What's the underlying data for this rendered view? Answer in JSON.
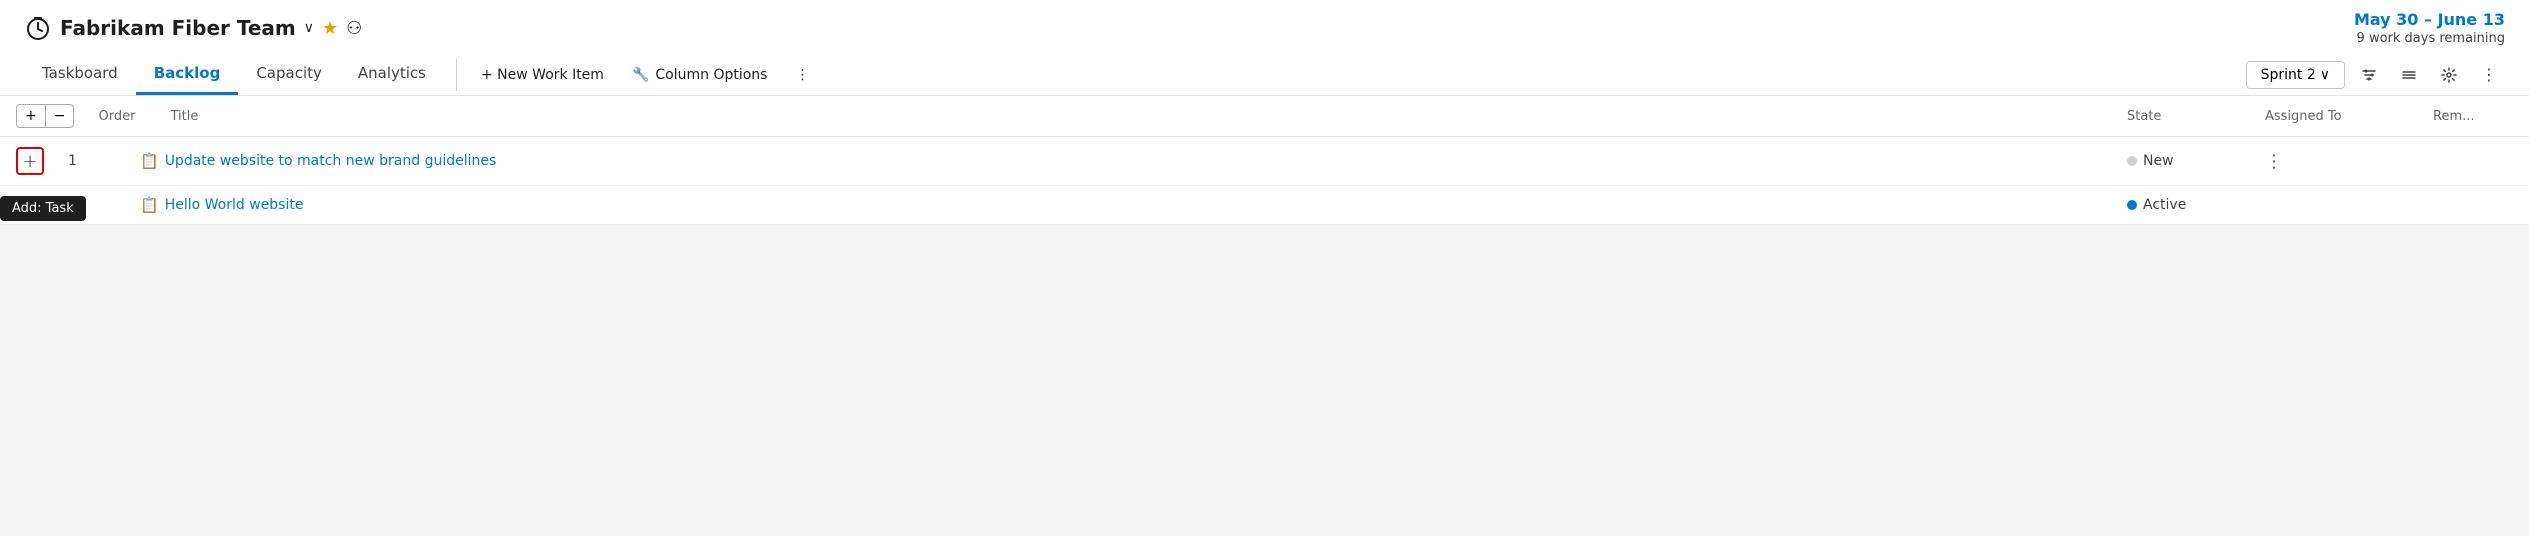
{
  "header": {
    "team_name": "Fabrikam Fiber Team",
    "chevron": "∨",
    "star": "★",
    "team_icon_unicode": "⏱",
    "members_icon": "⚇"
  },
  "sprint_info": {
    "dates": "May 30 – June 13",
    "days_remaining": "9 work days remaining"
  },
  "nav": {
    "tabs": [
      {
        "label": "Taskboard",
        "active": false
      },
      {
        "label": "Backlog",
        "active": true
      },
      {
        "label": "Capacity",
        "active": false
      },
      {
        "label": "Analytics",
        "active": false
      }
    ]
  },
  "toolbar": {
    "new_work_item_label": "+ New Work Item",
    "column_options_label": "Column Options",
    "more_label": "⋮"
  },
  "right_controls": {
    "sprint_selector_label": "Sprint 2",
    "filter_icon": "⚡",
    "group_icon": "≡",
    "settings_icon": "⚙",
    "more_icon": "⋮"
  },
  "table": {
    "headers": {
      "order": "Order",
      "title": "Title",
      "state": "State",
      "assigned_to": "Assigned To",
      "remaining": "Rem..."
    },
    "expand_plus": "+",
    "expand_minus": "−",
    "rows": [
      {
        "order": "1",
        "title": "Update website to match new brand guidelines",
        "state_label": "New",
        "state_type": "new",
        "assigned_to": "",
        "remaining": "",
        "show_add": true,
        "show_more": true
      },
      {
        "order": "",
        "title": "Hello World website",
        "state_label": "Active",
        "state_type": "active",
        "assigned_to": "",
        "remaining": "",
        "show_add": false,
        "show_more": false
      }
    ],
    "tooltip": "Add: Task"
  }
}
